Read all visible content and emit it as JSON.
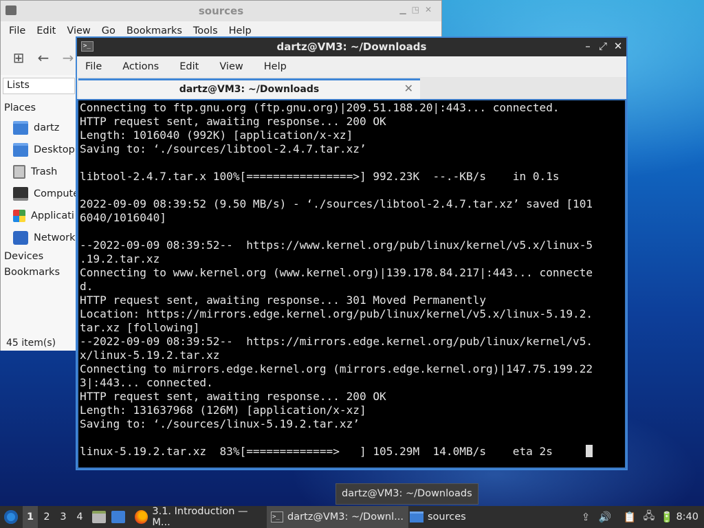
{
  "file_manager": {
    "title": "sources",
    "menu": [
      "File",
      "Edit",
      "View",
      "Go",
      "Bookmarks",
      "Tools",
      "Help"
    ],
    "lists_button": "Lists",
    "places_heading": "Places",
    "places": [
      {
        "label": "dartz",
        "icon": "home-folder-icon"
      },
      {
        "label": "Desktop",
        "icon": "desktop-folder-icon"
      },
      {
        "label": "Trash",
        "icon": "trash-icon"
      },
      {
        "label": "Compute",
        "icon": "computer-icon"
      },
      {
        "label": "Applicati",
        "icon": "applications-icon"
      },
      {
        "label": "Network",
        "icon": "network-icon"
      }
    ],
    "devices_heading": "Devices",
    "bookmarks_heading": "Bookmarks",
    "status": "45 item(s)"
  },
  "terminal": {
    "title": "dartz@VM3: ~/Downloads",
    "menu": [
      "File",
      "Actions",
      "Edit",
      "View",
      "Help"
    ],
    "tab_label": "dartz@VM3: ~/Downloads",
    "lines": [
      "Connecting to ftp.gnu.org (ftp.gnu.org)|209.51.188.20|:443... connected.",
      "HTTP request sent, awaiting response... 200 OK",
      "Length: 1016040 (992K) [application/x-xz]",
      "Saving to: ‘./sources/libtool-2.4.7.tar.xz’",
      "",
      "libtool-2.4.7.tar.x 100%[================>] 992.23K  --.-KB/s    in 0.1s",
      "",
      "2022-09-09 08:39:52 (9.50 MB/s) - ‘./sources/libtool-2.4.7.tar.xz’ saved [101",
      "6040/1016040]",
      "",
      "--2022-09-09 08:39:52--  https://www.kernel.org/pub/linux/kernel/v5.x/linux-5",
      ".19.2.tar.xz",
      "Connecting to www.kernel.org (www.kernel.org)|139.178.84.217|:443... connecte",
      "d.",
      "HTTP request sent, awaiting response... 301 Moved Permanently",
      "Location: https://mirrors.edge.kernel.org/pub/linux/kernel/v5.x/linux-5.19.2.",
      "tar.xz [following]",
      "--2022-09-09 08:39:52--  https://mirrors.edge.kernel.org/pub/linux/kernel/v5.",
      "x/linux-5.19.2.tar.xz",
      "Connecting to mirrors.edge.kernel.org (mirrors.edge.kernel.org)|147.75.199.22",
      "3|:443... connected.",
      "HTTP request sent, awaiting response... 200 OK",
      "Length: 131637968 (126M) [application/x-xz]",
      "Saving to: ‘./sources/linux-5.19.2.tar.xz’",
      "",
      "linux-5.19.2.tar.xz  83%[=============>   ] 105.29M  14.0MB/s    eta 2s     "
    ]
  },
  "tooltip": "dartz@VM3: ~/Downloads",
  "taskbar": {
    "workspaces": [
      "1",
      "2",
      "3",
      "4"
    ],
    "active_workspace": "1",
    "tasks": [
      {
        "label": "3.1. Introduction — M...",
        "icon": "firefox-icon"
      },
      {
        "label": "dartz@VM3: ~/Downl...",
        "icon": "terminal-icon"
      },
      {
        "label": "sources",
        "icon": "folder-icon"
      }
    ],
    "clock": "8:40"
  }
}
